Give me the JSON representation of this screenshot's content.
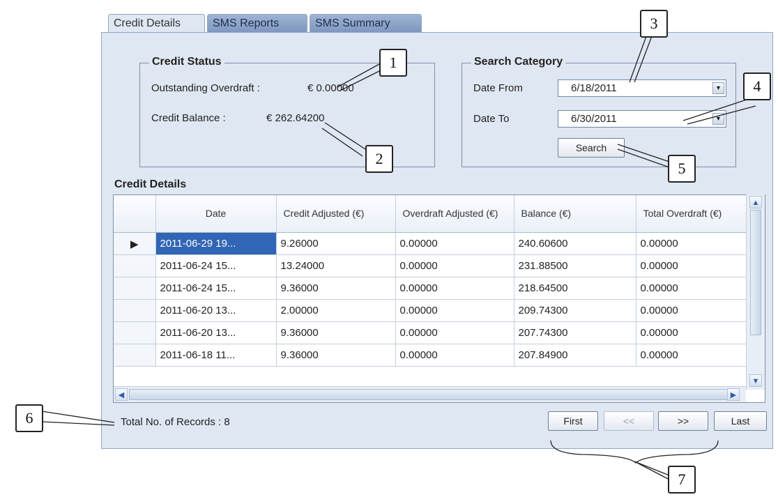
{
  "tabs": [
    {
      "label": "Credit Details",
      "active": true
    },
    {
      "label": "SMS Reports",
      "active": false
    },
    {
      "label": "SMS Summary",
      "active": false
    }
  ],
  "credit_status": {
    "title": "Credit Status",
    "overdraft_label": "Outstanding Overdraft :",
    "overdraft_value": "€ 0.00000",
    "balance_label": "Credit Balance :",
    "balance_value": "€ 262.64200"
  },
  "search_category": {
    "title": "Search Category",
    "date_from_label": "Date From",
    "date_from_value": "6/18/2011",
    "date_to_label": "Date To",
    "date_to_value": "6/30/2011",
    "search_button": "Search"
  },
  "grid": {
    "title": "Credit Details",
    "columns": [
      "Date",
      "Credit Adjusted (€)",
      "Overdraft Adjusted (€)",
      "Balance (€)",
      "Total Overdraft (€)"
    ],
    "rows": [
      [
        "2011-06-29 19...",
        "9.26000",
        "0.00000",
        "240.60600",
        "0.00000"
      ],
      [
        "2011-06-24 15...",
        "13.24000",
        "0.00000",
        "231.88500",
        "0.00000"
      ],
      [
        "2011-06-24 15...",
        "9.36000",
        "0.00000",
        "218.64500",
        "0.00000"
      ],
      [
        "2011-06-20 13...",
        "2.00000",
        "0.00000",
        "209.74300",
        "0.00000"
      ],
      [
        "2011-06-20 13...",
        "9.36000",
        "0.00000",
        "207.74300",
        "0.00000"
      ],
      [
        "2011-06-18 11...",
        "9.36000",
        "0.00000",
        "207.84900",
        "0.00000"
      ]
    ]
  },
  "footer": {
    "total_records": "Total No. of Records : 8",
    "first": "First",
    "prev": "<<",
    "next": ">>",
    "last": "Last"
  },
  "callouts": [
    "1",
    "2",
    "3",
    "4",
    "5",
    "6",
    "7"
  ],
  "colors": {
    "window_bg": "#dfe7f2",
    "selected_row": "#3165b5",
    "inactive_tab": "#8fa6c9"
  }
}
